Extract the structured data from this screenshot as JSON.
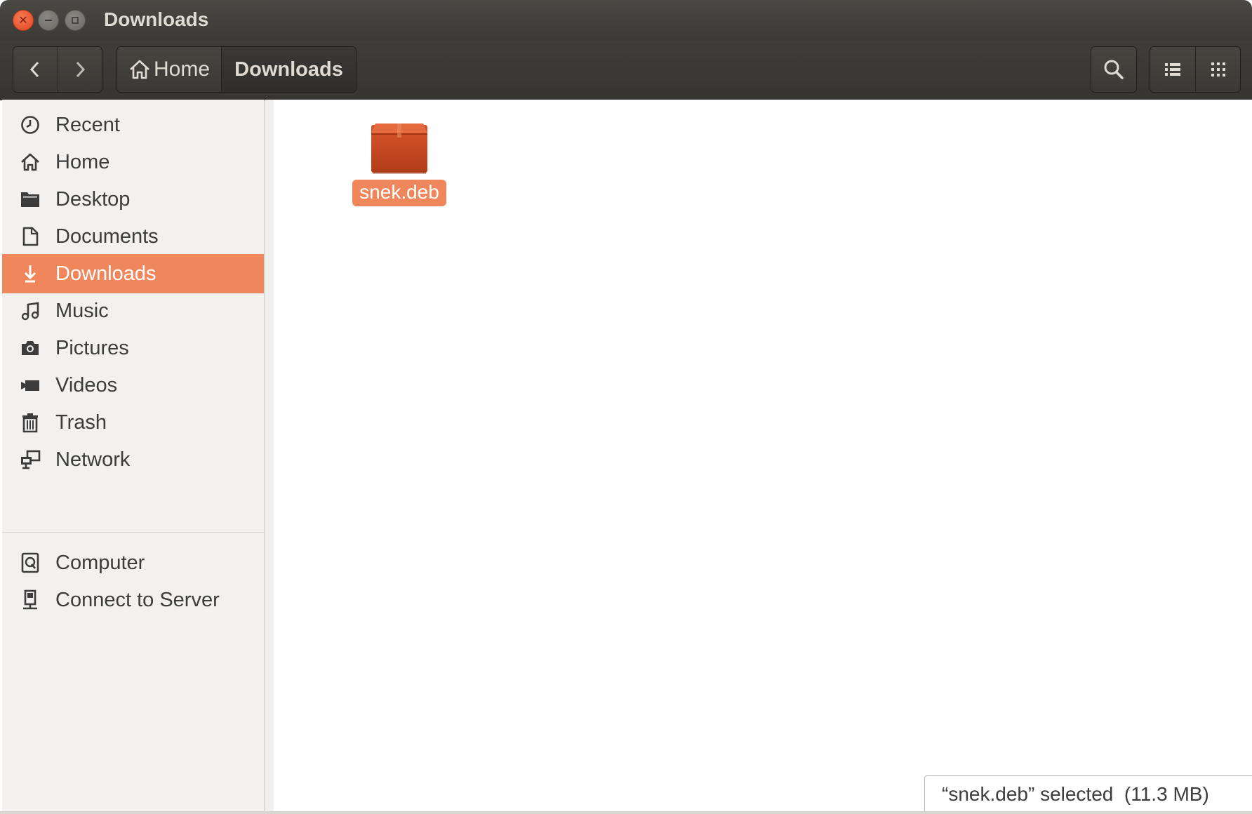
{
  "window": {
    "title": "Downloads"
  },
  "toolbar": {
    "back_icon": "chevron-left-icon",
    "forward_icon": "chevron-right-icon",
    "path": [
      {
        "label": "Home",
        "icon": "home-icon"
      },
      {
        "label": "Downloads"
      }
    ],
    "search_icon": "search-icon",
    "list_view_icon": "list-view-icon",
    "grid_view_icon": "grid-view-icon"
  },
  "sidebar": {
    "items": [
      {
        "label": "Recent",
        "icon": "clock-icon"
      },
      {
        "label": "Home",
        "icon": "home-icon"
      },
      {
        "label": "Desktop",
        "icon": "folder-icon"
      },
      {
        "label": "Documents",
        "icon": "document-icon"
      },
      {
        "label": "Downloads",
        "icon": "download-icon",
        "active": true
      },
      {
        "label": "Music",
        "icon": "music-icon"
      },
      {
        "label": "Pictures",
        "icon": "camera-icon"
      },
      {
        "label": "Videos",
        "icon": "video-icon"
      },
      {
        "label": "Trash",
        "icon": "trash-icon"
      },
      {
        "label": "Network",
        "icon": "network-icon"
      }
    ],
    "devices": [
      {
        "label": "Computer",
        "icon": "computer-icon"
      },
      {
        "label": "Connect to Server",
        "icon": "server-icon"
      }
    ]
  },
  "files": [
    {
      "name": "snek.deb",
      "icon": "package-icon",
      "selected": true
    }
  ],
  "status": {
    "text": "“snek.deb” selected  (11.3 MB)"
  },
  "colors": {
    "accent": "#f0875c",
    "titlebar": "#3b3a36",
    "close_button": "#e0461f"
  }
}
